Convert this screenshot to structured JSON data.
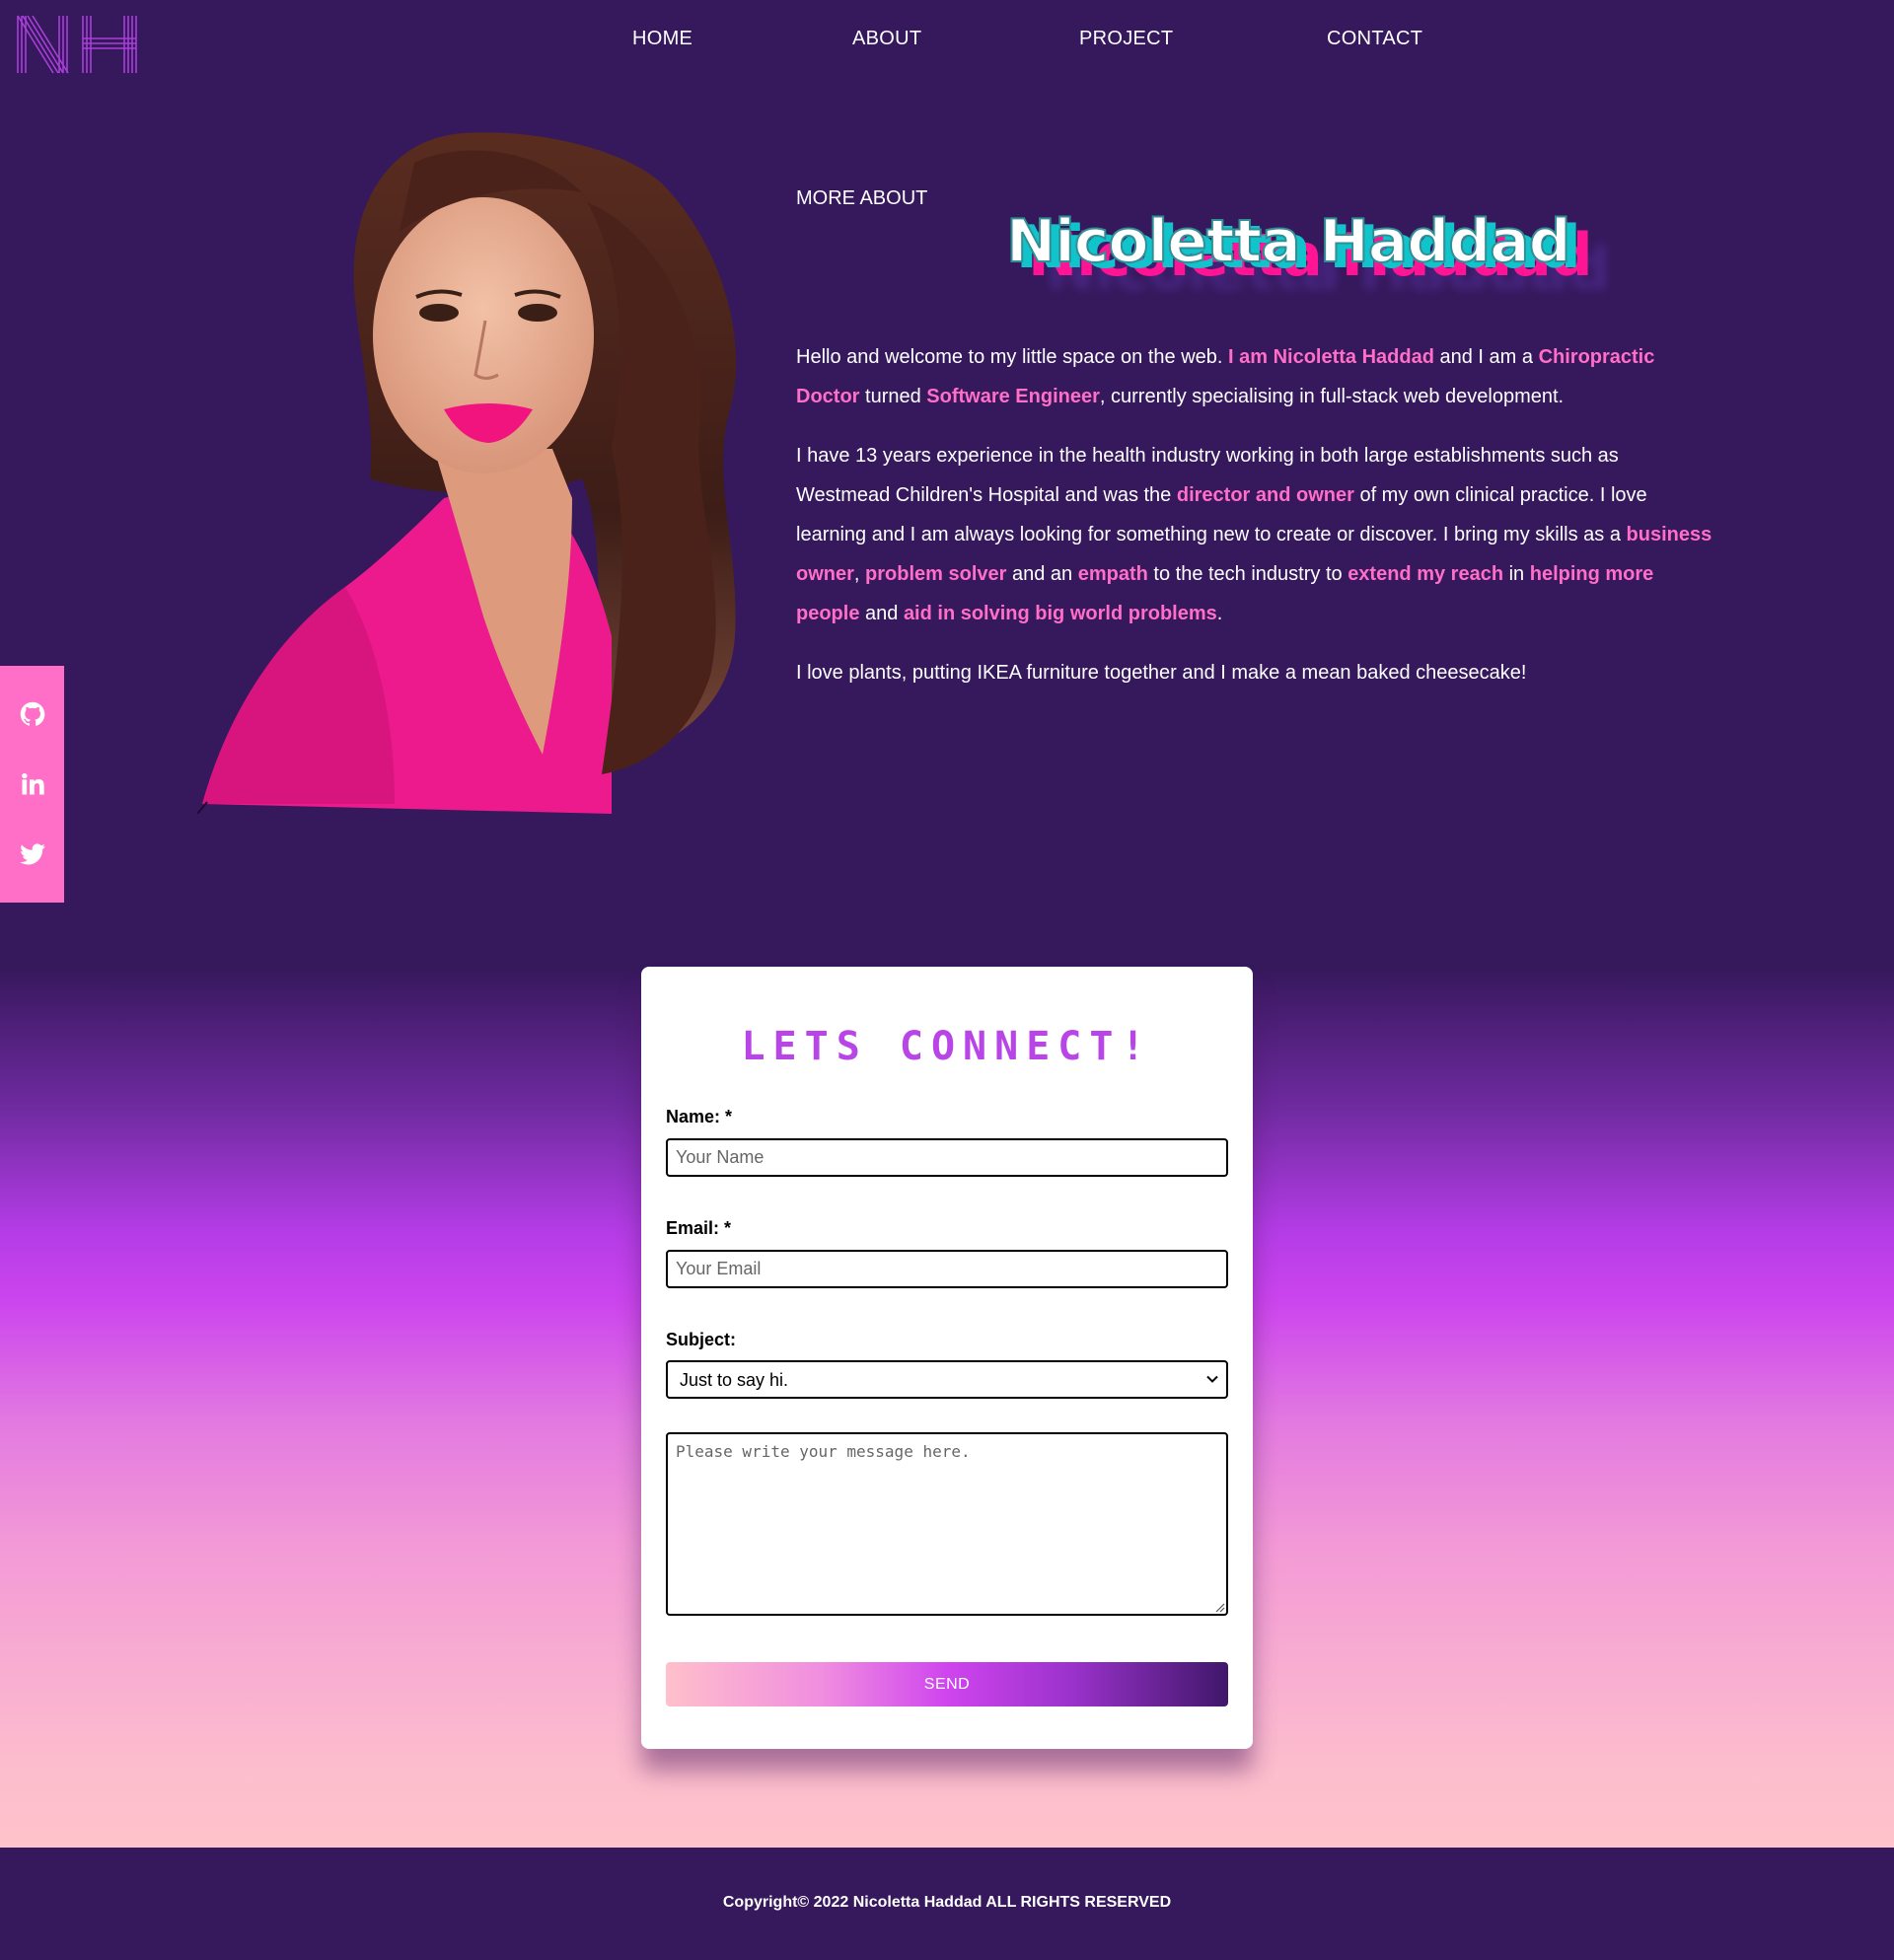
{
  "brand": {
    "logo_text": "NH",
    "accent": "#ff6ec7",
    "background": "#36185c"
  },
  "nav": {
    "items": [
      {
        "label": "HOME"
      },
      {
        "label": "ABOUT"
      },
      {
        "label": "PROJECT"
      },
      {
        "label": "CONTACT"
      }
    ]
  },
  "about": {
    "kicker": "MORE ABOUT",
    "name": "Nicoletta Haddad",
    "p1": {
      "t1": "Hello and welcome to my little space on the web. ",
      "h1": "I am Nicoletta Haddad",
      "t2": " and I am a ",
      "h2": "Chiropractic Doctor",
      "t3": " turned ",
      "h3": "Software Engineer",
      "t4": ", currently specialising in full-stack web development."
    },
    "p2": {
      "t1": "I have 13 years experience in the health industry working in both large establishments such as Westmead Children's Hospital and was the ",
      "h1": "director and owner",
      "t2": " of my own clinical practice. I love learning and I am always looking for something new to create or discover. I bring my skills as a ",
      "h2": "business owner",
      "t3": ", ",
      "h3": "problem solver",
      "t4": " and an ",
      "h4": "empath",
      "t5": " to the tech industry to ",
      "h5": "extend my reach",
      "t6": " in ",
      "h6": "helping more people",
      "t7": " and ",
      "h7": "aid in solving big world problems",
      "t8": "."
    },
    "p3": "I love plants, putting IKEA furniture together and I make a mean baked cheesecake!"
  },
  "social": {
    "items": [
      {
        "icon": "github-icon"
      },
      {
        "icon": "linkedin-icon"
      },
      {
        "icon": "twitter-icon"
      }
    ]
  },
  "contact": {
    "title": "LETS CONNECT!",
    "name_label": "Name: *",
    "name_placeholder": "Your Name",
    "email_label": "Email: *",
    "email_placeholder": "Your Email",
    "subject_label": "Subject:",
    "subject_value": "Just to say hi.",
    "message_placeholder": "Please write your message here.",
    "send_label": "SEND"
  },
  "footer": {
    "copyright": "Copyright© 2022 Nicoletta Haddad ALL RIGHTS RESERVED"
  }
}
